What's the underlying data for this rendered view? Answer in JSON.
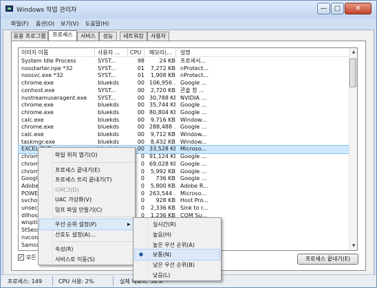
{
  "window": {
    "title": "Windows 작업 관리자",
    "minimize_glyph": "—",
    "maximize_glyph": "□",
    "close_glyph": "✕"
  },
  "menubar": [
    "파일(F)",
    "옵션(O)",
    "보기(V)",
    "도움말(H)"
  ],
  "tabs": [
    {
      "label": "응용 프로그램",
      "active": false
    },
    {
      "label": "프로세스",
      "active": true
    },
    {
      "label": "서비스",
      "active": false
    },
    {
      "label": "성능",
      "active": false
    },
    {
      "label": "네트워킹",
      "active": false
    },
    {
      "label": "사용자",
      "active": false
    }
  ],
  "columns": [
    "이미지 이름",
    "사용자 ...",
    "CPU",
    "메모리(...",
    "설명"
  ],
  "rows": [
    [
      "System Idle Process",
      "SYST...",
      "98",
      "24 KB",
      "프로세서..."
    ],
    [
      "nosstarter.npe *32",
      "SYST...",
      "01",
      "7,272 KB",
      "nProtect..."
    ],
    [
      "nossvc.exe *32",
      "SYST...",
      "01",
      "1,908 KB",
      "nProtect..."
    ],
    [
      "chrome.exe",
      "bluekds",
      "00",
      "106,956 ...",
      "Google ..."
    ],
    [
      "conhost.exe",
      "SYST...",
      "00",
      "2,720 KB",
      "콘솔 창 ..."
    ],
    [
      "nvstreamuseragent.exe",
      "SYST...",
      "00",
      "30,788 KB",
      "NVIDIA ..."
    ],
    [
      "chrome.exe",
      "bluekds",
      "00",
      "35,744 KB",
      "Google ..."
    ],
    [
      "chrome.exe",
      "bluekds",
      "00",
      "80,804 KB",
      "Google ..."
    ],
    [
      "calc.exe",
      "bluekds",
      "00",
      "9,716 KB",
      "Window..."
    ],
    [
      "chrome.exe",
      "bluekds",
      "00",
      "288,488 ...",
      "Google ..."
    ],
    [
      "calc.exe",
      "bluekds",
      "00",
      "9,712 KB",
      "Window..."
    ],
    [
      "taskmgr.exe",
      "bluekds",
      "00",
      "8,432 KB",
      "Window..."
    ],
    [
      "EXCEL.EXE",
      "bluekds",
      "00",
      "33,528 KB",
      "Microso..."
    ],
    [
      "chrom",
      "",
      "0",
      "91,124 KB",
      "Google ..."
    ],
    [
      "chrom",
      "",
      "0",
      "69,028 KB",
      "Google ..."
    ],
    [
      "chrom",
      "",
      "0",
      "5,992 KB",
      "Google ..."
    ],
    [
      "Google",
      "",
      "0",
      "736 KB",
      "Google ..."
    ],
    [
      "Adobe",
      "",
      "0",
      "5,800 KB",
      "Adobe R..."
    ],
    [
      "POWE",
      "",
      "0",
      "263,544 ...",
      "Microso..."
    ],
    [
      "svcho",
      "",
      "0",
      "928 KB",
      "Host Pro..."
    ],
    [
      "unsec",
      "",
      "0",
      "2,336 KB",
      "Sink to r..."
    ],
    [
      "dllhost",
      "",
      "0",
      "1,236 KB",
      "COM Su..."
    ],
    [
      "wisptis",
      "",
      "",
      "",
      ""
    ],
    [
      "StSess",
      "",
      "",
      "",
      ""
    ],
    [
      "nvcont",
      "",
      "",
      "",
      ""
    ],
    [
      "Samsu",
      "",
      "",
      "",
      ""
    ]
  ],
  "selected_row": 12,
  "context_menu": {
    "items": [
      {
        "label": "파일 위치 열기(O)",
        "disabled": false
      },
      {
        "sep": true
      },
      {
        "label": "프로세스 끝내기(E)",
        "disabled": false
      },
      {
        "label": "프로세스 트리 끝내기(T)",
        "disabled": false
      },
      {
        "label": "디버그(D)",
        "disabled": true
      },
      {
        "label": "UAC 가상화(V)",
        "disabled": false
      },
      {
        "label": "덤프 파일 만들기(C)",
        "disabled": false
      },
      {
        "sep": true
      },
      {
        "label": "우선 순위 설정(P)",
        "disabled": false,
        "submenu": true,
        "highlight": true
      },
      {
        "label": "선호도 설정(A)...",
        "disabled": false
      },
      {
        "sep": true
      },
      {
        "label": "속성(R)",
        "disabled": false
      },
      {
        "label": "서비스로 이동(S)",
        "disabled": false
      }
    ],
    "submenu_arrow": "▶"
  },
  "priority_menu": {
    "items": [
      {
        "label": "실시간(R)",
        "checked": false
      },
      {
        "label": "높음(H)",
        "checked": false
      },
      {
        "label": "높은 우선 순위(A)",
        "checked": false
      },
      {
        "label": "보통(N)",
        "checked": true
      },
      {
        "label": "낮은 우선 순위(B)",
        "checked": false
      },
      {
        "label": "낮음(L)",
        "checked": false
      }
    ],
    "check_glyph": "●"
  },
  "show_all_users": {
    "label": "모든",
    "checked": true,
    "check_glyph": "✓"
  },
  "end_process_button": "프로세스 끝내기(E)",
  "status": {
    "processes": "프로세스: 149",
    "cpu": "CPU 사용: 2%",
    "memory": "실제 메모리: 50%"
  },
  "scroll_up": "▲",
  "scroll_down": "▼"
}
